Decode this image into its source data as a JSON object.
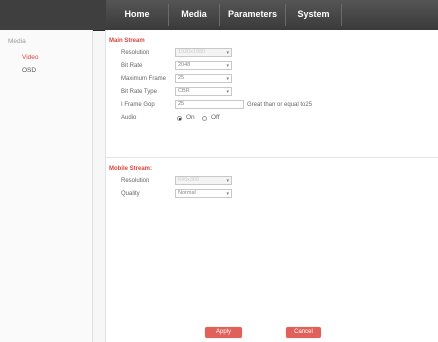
{
  "nav": {
    "items": [
      "Home",
      "Media",
      "Parameters",
      "System"
    ]
  },
  "sidebar": {
    "title": "Media",
    "items": [
      "Video",
      "OSD"
    ],
    "active_color": "#d9463e"
  },
  "main_stream": {
    "title": "Main Stream",
    "fields": [
      {
        "label": "Resolution",
        "value": "1920x1080",
        "disabled": true
      },
      {
        "label": "Bit Rate",
        "value": "2048"
      },
      {
        "label": "Maximum Frame",
        "value": "25"
      },
      {
        "label": "Bit Rate Type",
        "value": "CBR"
      }
    ],
    "iframe": {
      "label": "I Frame Gop",
      "value": "25",
      "hint": "Great than or equal to25"
    },
    "audio": {
      "label": "Audio",
      "on": "On",
      "off": "Off",
      "selected": "On"
    }
  },
  "mobile_stream": {
    "title": "Mobile Stream:",
    "fields": [
      {
        "label": "Resolution",
        "value": "640x360",
        "disabled": true
      },
      {
        "label": "Quality",
        "value": "Normal"
      }
    ]
  },
  "buttons": {
    "apply": "Apply",
    "cancel": "Cancel"
  },
  "colors": {
    "accent": "#d9463e",
    "button": "#e0605a",
    "nav_bg": "#3f3f3f"
  }
}
